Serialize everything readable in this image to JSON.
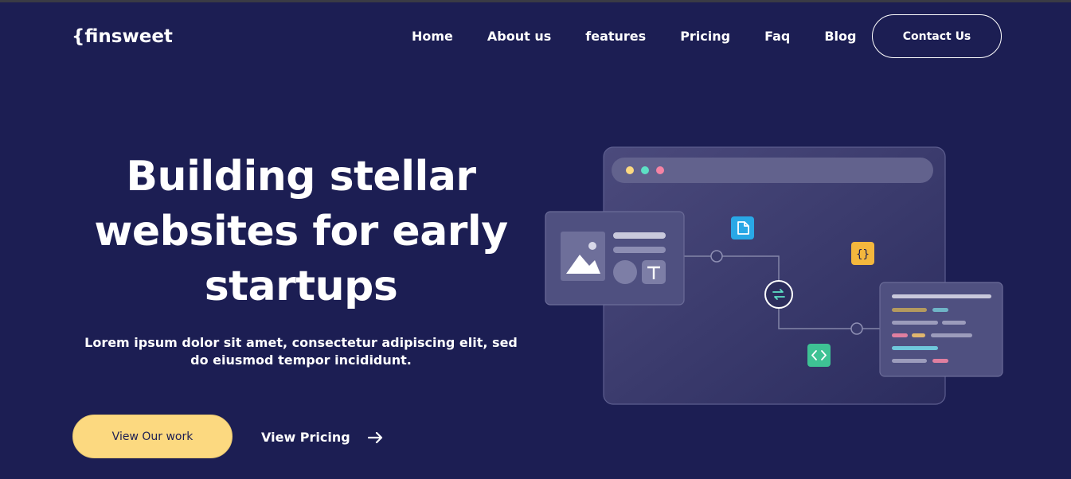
{
  "brand": {
    "logo": "{finsweet"
  },
  "nav": {
    "items": [
      {
        "label": "Home"
      },
      {
        "label": "About us"
      },
      {
        "label": "features"
      },
      {
        "label": "Pricing"
      },
      {
        "label": "Faq"
      },
      {
        "label": "Blog"
      }
    ],
    "contact_label": "Contact Us"
  },
  "hero": {
    "title": "Building stellar websites for early startups",
    "subtitle": "Lorem ipsum dolor sit amet, consectetur adipiscing elit, sed do eiusmod tempor incididunt.",
    "primary_cta": "View Our work",
    "secondary_cta": "View Pricing",
    "secondary_icon": "arrow-right-icon"
  },
  "illustration": {
    "window_dots": [
      "#fcd980",
      "#5de0c5",
      "#f583a4"
    ],
    "icons": [
      "image-icon",
      "text-icon",
      "file-icon",
      "curly-braces-icon",
      "sync-icon",
      "code-icon"
    ],
    "colors": {
      "file_badge": "#29a8e6",
      "braces_badge": "#f4b73d",
      "code_badge": "#3ec294"
    }
  },
  "colors": {
    "background": "#1c1e53",
    "accent": "#fcd980",
    "text": "#ffffff"
  }
}
